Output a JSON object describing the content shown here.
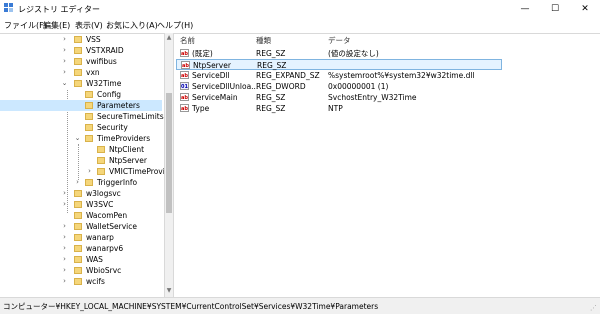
{
  "window": {
    "title": "レジストリ エディター",
    "minimize": "—",
    "maximize": "☐",
    "close": "✕"
  },
  "menu": [
    "ファイル(F)",
    "編集(E)",
    "表示(V)",
    "お気に入り(A)",
    "ヘルプ(H)"
  ],
  "tree": [
    {
      "label": "VSS",
      "expander": "›"
    },
    {
      "label": "VSTXRAID",
      "expander": "›"
    },
    {
      "label": "vwifibus",
      "expander": "›"
    },
    {
      "label": "vxn",
      "expander": "›"
    },
    {
      "label": "W32Time",
      "expander": "⌄"
    },
    {
      "label": "Config",
      "expander": ""
    },
    {
      "label": "Parameters",
      "expander": ""
    },
    {
      "label": "SecureTimeLimits",
      "expander": ""
    },
    {
      "label": "Security",
      "expander": ""
    },
    {
      "label": "TimeProviders",
      "expander": "⌄"
    },
    {
      "label": "NtpClient",
      "expander": ""
    },
    {
      "label": "NtpServer",
      "expander": ""
    },
    {
      "label": "VMICTimeProvic",
      "expander": "›"
    },
    {
      "label": "TriggerInfo",
      "expander": "›"
    },
    {
      "label": "w3logsvc",
      "expander": "›"
    },
    {
      "label": "W3SVC",
      "expander": "›"
    },
    {
      "label": "WacomPen",
      "expander": ""
    },
    {
      "label": "WalletService",
      "expander": "›"
    },
    {
      "label": "wanarp",
      "expander": "›"
    },
    {
      "label": "wanarpv6",
      "expander": "›"
    },
    {
      "label": "WAS",
      "expander": "›"
    },
    {
      "label": "WbioSrvc",
      "expander": "›"
    },
    {
      "label": "wcifs",
      "expander": "›"
    }
  ],
  "columns": {
    "name": "名前",
    "type": "種類",
    "data": "データ"
  },
  "values": [
    {
      "icon": "ab",
      "name": "(既定)",
      "type": "REG_SZ",
      "data": "(値の設定なし)"
    },
    {
      "icon": "ab",
      "name": "NtpServer",
      "type": "REG_SZ",
      "data": ""
    },
    {
      "icon": "ab",
      "name": "ServiceDll",
      "type": "REG_EXPAND_SZ",
      "data": "%systemroot%¥system32¥w32time.dll"
    },
    {
      "icon": "01",
      "name": "ServiceDllUnloa...",
      "type": "REG_DWORD",
      "data": "0x00000001 (1)"
    },
    {
      "icon": "ab",
      "name": "ServiceMain",
      "type": "REG_SZ",
      "data": "SvchostEntry_W32Time"
    },
    {
      "icon": "ab",
      "name": "Type",
      "type": "REG_SZ",
      "data": "NTP"
    }
  ],
  "status": "コンピューター¥HKEY_LOCAL_MACHINE¥SYSTEM¥CurrentControlSet¥Services¥W32Time¥Parameters"
}
